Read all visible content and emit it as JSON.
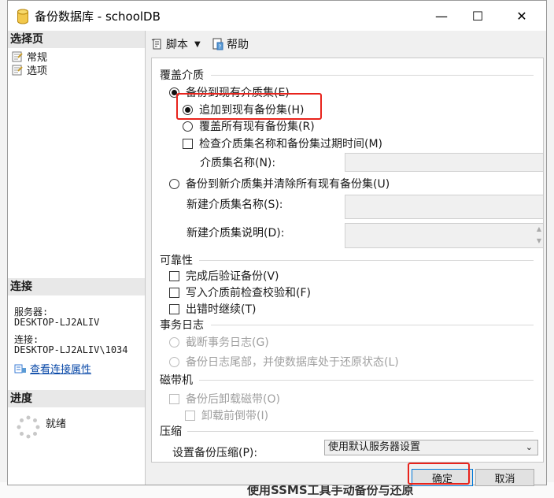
{
  "window": {
    "title": "备份数据库 - schoolDB",
    "controls": {
      "minimize": "—",
      "maximize": "☐",
      "close": "✕"
    }
  },
  "left_pane": {
    "select_page_header": "选择页",
    "pages": [
      {
        "label": "常规"
      },
      {
        "label": "选项"
      }
    ],
    "connection_header": "连接",
    "server_label": "服务器:",
    "server_value": "DESKTOP-LJ2ALIV",
    "connection_label": "连接:",
    "connection_value": "DESKTOP-LJ2ALIV\\1034",
    "view_connection_properties": "查看连接属性",
    "progress_header": "进度",
    "progress_status": "就绪"
  },
  "toolbar": {
    "script_label": "脚本",
    "help_label": "帮助"
  },
  "overwrite_media": {
    "title": "覆盖介质",
    "backup_existing_media_set": "备份到现有介质集(E)",
    "append_to_existing": "追加到现有备份集(H)",
    "overwrite_all_existing": "覆盖所有现有备份集(R)",
    "check_media_set_name": "检查介质集名称和备份集过期时间(M)",
    "media_set_name_label": "介质集名称(N):",
    "backup_new_media_set": "备份到新介质集并清除所有现有备份集(U)",
    "new_media_set_name_label": "新建介质集名称(S):",
    "new_media_set_desc_label": "新建介质集说明(D):"
  },
  "reliability": {
    "title": "可靠性",
    "verify_backup": "完成后验证备份(V)",
    "perform_checksum": "写入介质前检查校验和(F)",
    "continue_on_error": "出错时继续(T)"
  },
  "transaction_log": {
    "title": "事务日志",
    "truncate_log": "截断事务日志(G)",
    "backup_tail_log": "备份日志尾部，并使数据库处于还原状态(L)"
  },
  "tape_drive": {
    "title": "磁带机",
    "unload_tape": "备份后卸载磁带(O)",
    "rewind_tape": "卸载前倒带(I)"
  },
  "compression": {
    "title": "压缩",
    "set_backup_compression": "设置备份压缩(P):",
    "selected_option": "使用默认服务器设置"
  },
  "footer": {
    "ok_label": "确定",
    "cancel_label": "取消"
  },
  "background": {
    "bottom_text": "使用SSMS工具手动备份与还原"
  },
  "colors": {
    "highlight_red": "#e8231c",
    "link_blue": "#0b4aa8",
    "focus_blue": "#0078d7"
  }
}
